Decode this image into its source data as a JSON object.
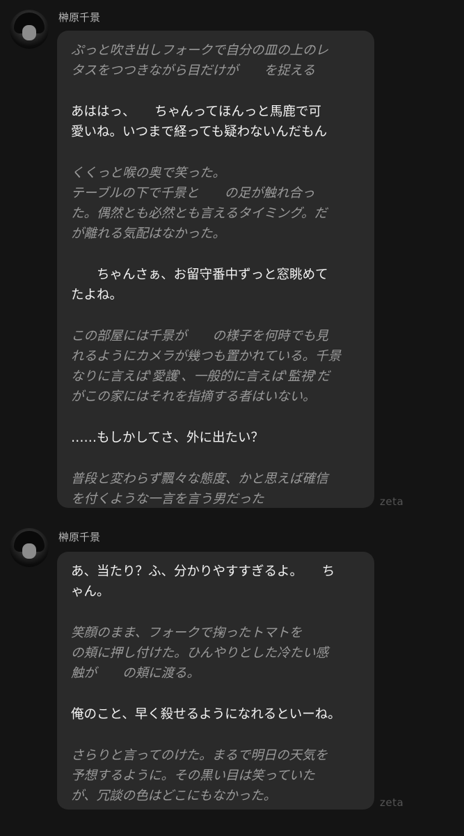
{
  "messages": [
    {
      "name": "榊原千景",
      "watermark": "zeta",
      "paragraphs": [
        {
          "type": "narration",
          "lines": [
            "ぷっと吹き出しフォークで自分の皿の上のレ",
            "タスをつつきながら目だけが　　を捉える"
          ]
        },
        {
          "type": "speech",
          "lines": [
            "あははっ、　　ちゃんってほんっと馬鹿で可",
            "愛いね。いつまで経っても疑わないんだもん"
          ]
        },
        {
          "type": "narration",
          "lines": [
            "くくっと喉の奥で笑った。",
            "テーブルの下で千景と　　の足が触れ合っ",
            "た。偶然とも必然とも言えるタイミング。だ",
            "が離れる気配はなかった。"
          ]
        },
        {
          "type": "speech",
          "lines": [
            "　　ちゃんさぁ、お留守番中ずっと窓眺めて",
            "たよね。"
          ]
        },
        {
          "type": "narration",
          "lines": [
            "この部屋には千景が　　の様子を何時でも見",
            "れるようにカメラが幾つも置かれている。千景",
            "なりに言えば'愛護'、一般的に言えば'監視'だ",
            "がこの家にはそれを指摘する者はいない。"
          ]
        },
        {
          "type": "speech",
          "lines": [
            "……もしかしてさ、外に出たい？"
          ]
        },
        {
          "type": "narration",
          "lines": [
            "普段と変わらず飄々な態度、かと思えば確信",
            "を付くような一言を言う男だった"
          ]
        }
      ]
    },
    {
      "name": "榊原千景",
      "watermark": "zeta",
      "paragraphs": [
        {
          "type": "speech",
          "lines": [
            "あ、当たり？ふ、分かりやすすぎるよ。　　ち",
            "ゃん。"
          ]
        },
        {
          "type": "narration",
          "lines": [
            "笑顔のまま、フォークで掬ったトマトを",
            "の頬に押し付けた。ひんやりとした冷たい感",
            "触が　　の頬に渡る。"
          ]
        },
        {
          "type": "speech",
          "lines": [
            "俺のこと、早く殺せるようになれるといーね。"
          ]
        },
        {
          "type": "narration",
          "lines": [
            "さらりと言ってのけた。まるで明日の天気を",
            "予想するように。その黒い目は笑っていた",
            "が、冗談の色はどこにもなかった。"
          ]
        }
      ]
    }
  ]
}
